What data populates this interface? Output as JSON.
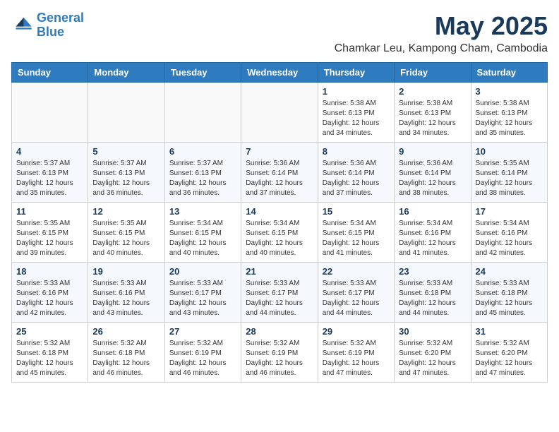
{
  "header": {
    "logo_line1": "General",
    "logo_line2": "Blue",
    "month": "May 2025",
    "location": "Chamkar Leu, Kampong Cham, Cambodia"
  },
  "weekdays": [
    "Sunday",
    "Monday",
    "Tuesday",
    "Wednesday",
    "Thursday",
    "Friday",
    "Saturday"
  ],
  "weeks": [
    [
      {
        "day": "",
        "info": ""
      },
      {
        "day": "",
        "info": ""
      },
      {
        "day": "",
        "info": ""
      },
      {
        "day": "",
        "info": ""
      },
      {
        "day": "1",
        "info": "Sunrise: 5:38 AM\nSunset: 6:13 PM\nDaylight: 12 hours\nand 34 minutes."
      },
      {
        "day": "2",
        "info": "Sunrise: 5:38 AM\nSunset: 6:13 PM\nDaylight: 12 hours\nand 34 minutes."
      },
      {
        "day": "3",
        "info": "Sunrise: 5:38 AM\nSunset: 6:13 PM\nDaylight: 12 hours\nand 35 minutes."
      }
    ],
    [
      {
        "day": "4",
        "info": "Sunrise: 5:37 AM\nSunset: 6:13 PM\nDaylight: 12 hours\nand 35 minutes."
      },
      {
        "day": "5",
        "info": "Sunrise: 5:37 AM\nSunset: 6:13 PM\nDaylight: 12 hours\nand 36 minutes."
      },
      {
        "day": "6",
        "info": "Sunrise: 5:37 AM\nSunset: 6:13 PM\nDaylight: 12 hours\nand 36 minutes."
      },
      {
        "day": "7",
        "info": "Sunrise: 5:36 AM\nSunset: 6:14 PM\nDaylight: 12 hours\nand 37 minutes."
      },
      {
        "day": "8",
        "info": "Sunrise: 5:36 AM\nSunset: 6:14 PM\nDaylight: 12 hours\nand 37 minutes."
      },
      {
        "day": "9",
        "info": "Sunrise: 5:36 AM\nSunset: 6:14 PM\nDaylight: 12 hours\nand 38 minutes."
      },
      {
        "day": "10",
        "info": "Sunrise: 5:35 AM\nSunset: 6:14 PM\nDaylight: 12 hours\nand 38 minutes."
      }
    ],
    [
      {
        "day": "11",
        "info": "Sunrise: 5:35 AM\nSunset: 6:15 PM\nDaylight: 12 hours\nand 39 minutes."
      },
      {
        "day": "12",
        "info": "Sunrise: 5:35 AM\nSunset: 6:15 PM\nDaylight: 12 hours\nand 40 minutes."
      },
      {
        "day": "13",
        "info": "Sunrise: 5:34 AM\nSunset: 6:15 PM\nDaylight: 12 hours\nand 40 minutes."
      },
      {
        "day": "14",
        "info": "Sunrise: 5:34 AM\nSunset: 6:15 PM\nDaylight: 12 hours\nand 40 minutes."
      },
      {
        "day": "15",
        "info": "Sunrise: 5:34 AM\nSunset: 6:15 PM\nDaylight: 12 hours\nand 41 minutes."
      },
      {
        "day": "16",
        "info": "Sunrise: 5:34 AM\nSunset: 6:16 PM\nDaylight: 12 hours\nand 41 minutes."
      },
      {
        "day": "17",
        "info": "Sunrise: 5:34 AM\nSunset: 6:16 PM\nDaylight: 12 hours\nand 42 minutes."
      }
    ],
    [
      {
        "day": "18",
        "info": "Sunrise: 5:33 AM\nSunset: 6:16 PM\nDaylight: 12 hours\nand 42 minutes."
      },
      {
        "day": "19",
        "info": "Sunrise: 5:33 AM\nSunset: 6:16 PM\nDaylight: 12 hours\nand 43 minutes."
      },
      {
        "day": "20",
        "info": "Sunrise: 5:33 AM\nSunset: 6:17 PM\nDaylight: 12 hours\nand 43 minutes."
      },
      {
        "day": "21",
        "info": "Sunrise: 5:33 AM\nSunset: 6:17 PM\nDaylight: 12 hours\nand 44 minutes."
      },
      {
        "day": "22",
        "info": "Sunrise: 5:33 AM\nSunset: 6:17 PM\nDaylight: 12 hours\nand 44 minutes."
      },
      {
        "day": "23",
        "info": "Sunrise: 5:33 AM\nSunset: 6:18 PM\nDaylight: 12 hours\nand 44 minutes."
      },
      {
        "day": "24",
        "info": "Sunrise: 5:33 AM\nSunset: 6:18 PM\nDaylight: 12 hours\nand 45 minutes."
      }
    ],
    [
      {
        "day": "25",
        "info": "Sunrise: 5:32 AM\nSunset: 6:18 PM\nDaylight: 12 hours\nand 45 minutes."
      },
      {
        "day": "26",
        "info": "Sunrise: 5:32 AM\nSunset: 6:18 PM\nDaylight: 12 hours\nand 46 minutes."
      },
      {
        "day": "27",
        "info": "Sunrise: 5:32 AM\nSunset: 6:19 PM\nDaylight: 12 hours\nand 46 minutes."
      },
      {
        "day": "28",
        "info": "Sunrise: 5:32 AM\nSunset: 6:19 PM\nDaylight: 12 hours\nand 46 minutes."
      },
      {
        "day": "29",
        "info": "Sunrise: 5:32 AM\nSunset: 6:19 PM\nDaylight: 12 hours\nand 47 minutes."
      },
      {
        "day": "30",
        "info": "Sunrise: 5:32 AM\nSunset: 6:20 PM\nDaylight: 12 hours\nand 47 minutes."
      },
      {
        "day": "31",
        "info": "Sunrise: 5:32 AM\nSunset: 6:20 PM\nDaylight: 12 hours\nand 47 minutes."
      }
    ]
  ]
}
